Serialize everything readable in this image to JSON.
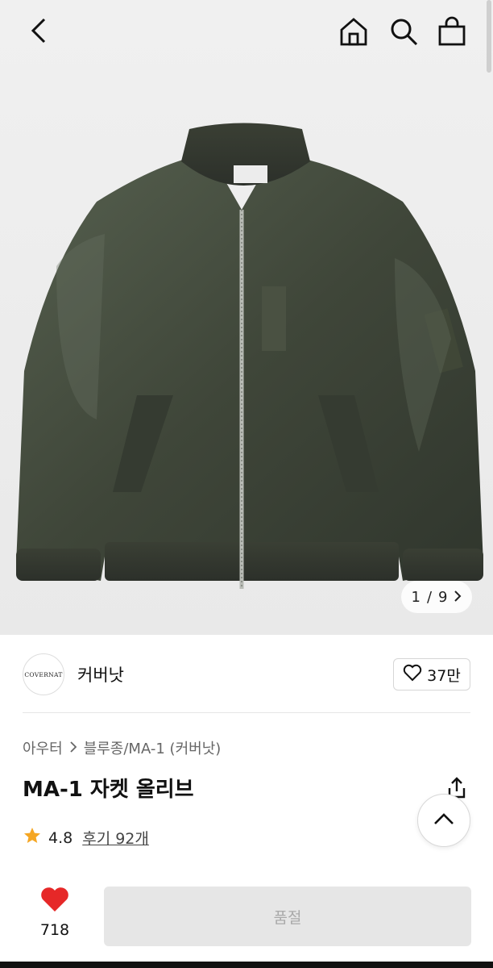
{
  "hero": {
    "page_current": "1",
    "page_sep": "/",
    "page_total": "9"
  },
  "brand": {
    "logo_text": "COVERNAT",
    "name": "커버낫",
    "like_count": "37만"
  },
  "breadcrumb": {
    "items": [
      "아우터",
      "블루종/MA-1 (커버낫)"
    ]
  },
  "product": {
    "title": "MA-1 자켓 올리브",
    "rating": "4.8",
    "reviews": "후기 92개"
  },
  "bottom": {
    "wish_count": "718",
    "soldout_label": "품절"
  },
  "colors": {
    "accent_red": "#e62828",
    "star": "#f5a623",
    "jacket": "#4a5245"
  }
}
